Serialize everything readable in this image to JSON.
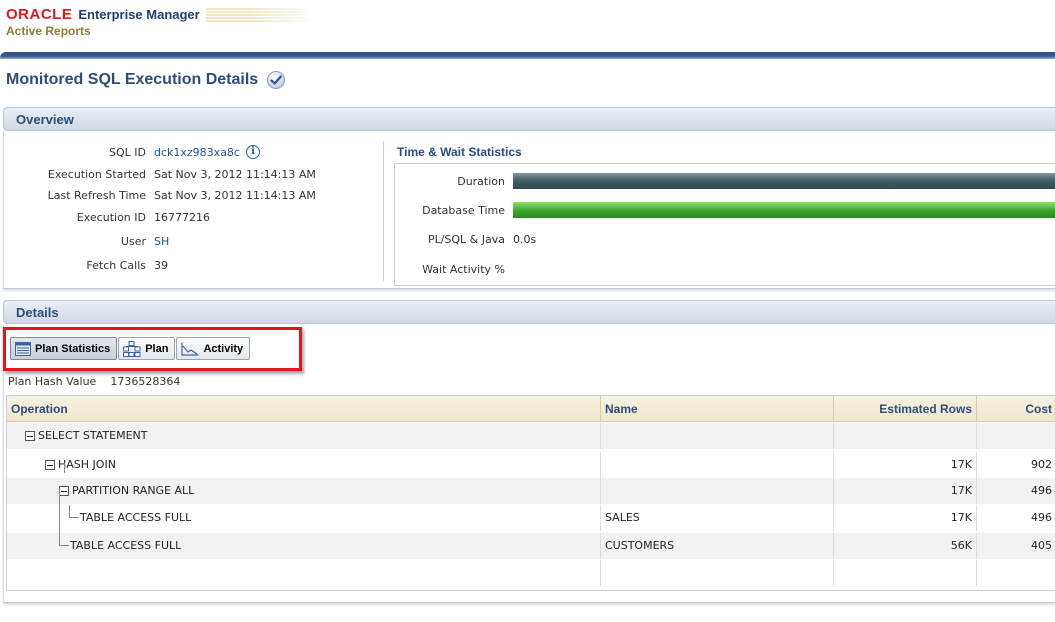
{
  "header": {
    "oracle": "ORACLE",
    "product": "Enterprise Manager",
    "subtitle": "Active Reports"
  },
  "page": {
    "title": "Monitored SQL Execution Details"
  },
  "overview": {
    "heading": "Overview",
    "fields": [
      {
        "label": "SQL ID",
        "value": "dck1xz983xa8c"
      },
      {
        "label": "Execution Started",
        "value": "Sat Nov 3, 2012 11:14:13 AM"
      },
      {
        "label": "Last Refresh Time",
        "value": "Sat Nov 3, 2012 11:14:13 AM"
      },
      {
        "label": "Execution ID",
        "value": "16777216"
      },
      {
        "label": "User",
        "value": "SH"
      },
      {
        "label": "Fetch Calls",
        "value": "39"
      }
    ],
    "time_wait": {
      "title": "Time & Wait Statistics",
      "duration_label": "Duration",
      "db_time_label": "Database Time",
      "plsql_label": "PL/SQL & Java",
      "plsql_value": "0.0s",
      "wait_label": "Wait Activity %"
    }
  },
  "details": {
    "heading": "Details",
    "tabs": [
      {
        "label": "Plan Statistics",
        "icon": "table-icon"
      },
      {
        "label": "Plan",
        "icon": "tree-icon"
      },
      {
        "label": "Activity",
        "icon": "line-chart-icon"
      }
    ],
    "plan_hash_label": "Plan Hash Value",
    "plan_hash_value": "1736528364"
  },
  "grid": {
    "columns": [
      "Operation",
      "Name",
      "Estimated Rows",
      "Cost"
    ],
    "rows": [
      {
        "operation": "SELECT STATEMENT",
        "name": "",
        "rows": "",
        "cost": ""
      },
      {
        "operation": "HASH JOIN",
        "name": "",
        "rows": "17K",
        "cost": "902"
      },
      {
        "operation": "PARTITION RANGE ALL",
        "name": "",
        "rows": "17K",
        "cost": "496"
      },
      {
        "operation": "TABLE ACCESS FULL",
        "name": "SALES",
        "rows": "17K",
        "cost": "496"
      },
      {
        "operation": "TABLE ACCESS FULL",
        "name": "CUSTOMERS",
        "rows": "56K",
        "cost": "405"
      }
    ]
  }
}
